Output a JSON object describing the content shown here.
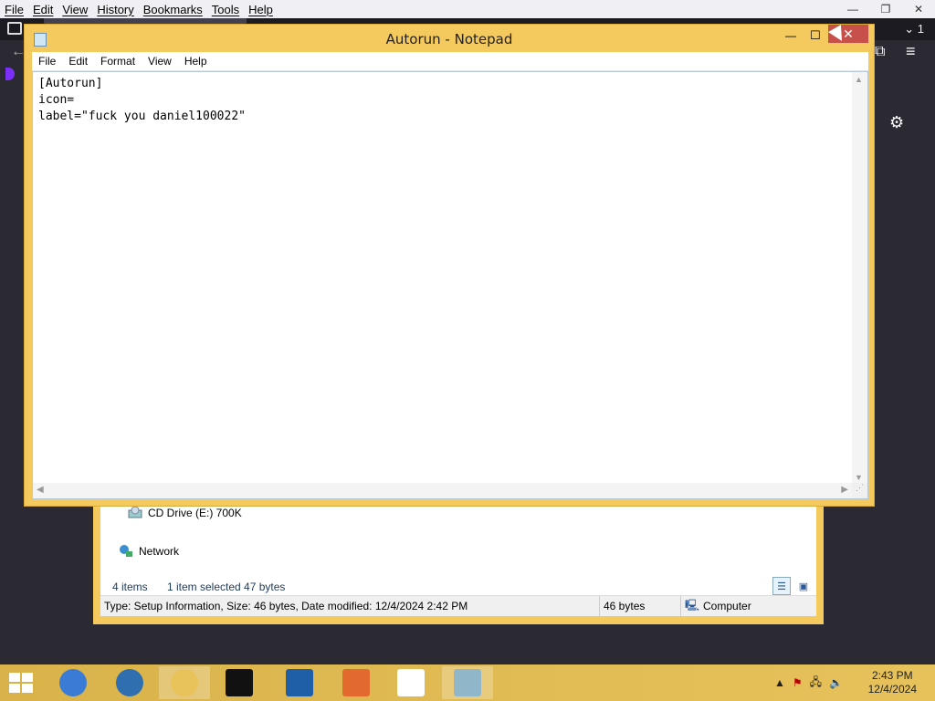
{
  "firefox": {
    "menu": [
      "File",
      "Edit",
      "View",
      "History",
      "Bookmarks",
      "Tools",
      "Help"
    ],
    "tab_count": "1"
  },
  "explorer": {
    "items": [
      {
        "label": "CD Drive (E:) 700K",
        "icon": "cd-drive-icon"
      },
      {
        "label": "Network",
        "icon": "network-icon"
      }
    ],
    "count_text": "4 items",
    "selected_text": "1 item selected  47 bytes",
    "status_info": "Type: Setup Information, Size: 46 bytes, Date modified: 12/4/2024 2:42 PM",
    "status_size": "46 bytes",
    "status_location": "Computer"
  },
  "notepad": {
    "title": "Autorun - Notepad",
    "menu": [
      "File",
      "Edit",
      "Format",
      "View",
      "Help"
    ],
    "content": "[Autorun]\nicon=\nlabel=\"fuck you daniel100022\""
  },
  "taskbar": {
    "apps": [
      {
        "name": "chrome-icon",
        "color": "#3a7bd5",
        "active": false
      },
      {
        "name": "browser-icon",
        "color": "#2f6fb0",
        "active": false
      },
      {
        "name": "file-explorer-icon",
        "color": "#e8c35a",
        "active": true
      },
      {
        "name": "command-prompt-icon",
        "color": "#111111",
        "active": false
      },
      {
        "name": "filezilla-icon",
        "color": "#1f5fa8",
        "active": false
      },
      {
        "name": "firefox-dev-icon",
        "color": "#e36a2e",
        "active": false
      },
      {
        "name": "notepad-list-icon",
        "color": "#ffffff",
        "active": false
      },
      {
        "name": "notepad-icon",
        "color": "#8fb7c9",
        "active": true
      }
    ],
    "time": "2:43 PM",
    "date": "12/4/2024"
  }
}
